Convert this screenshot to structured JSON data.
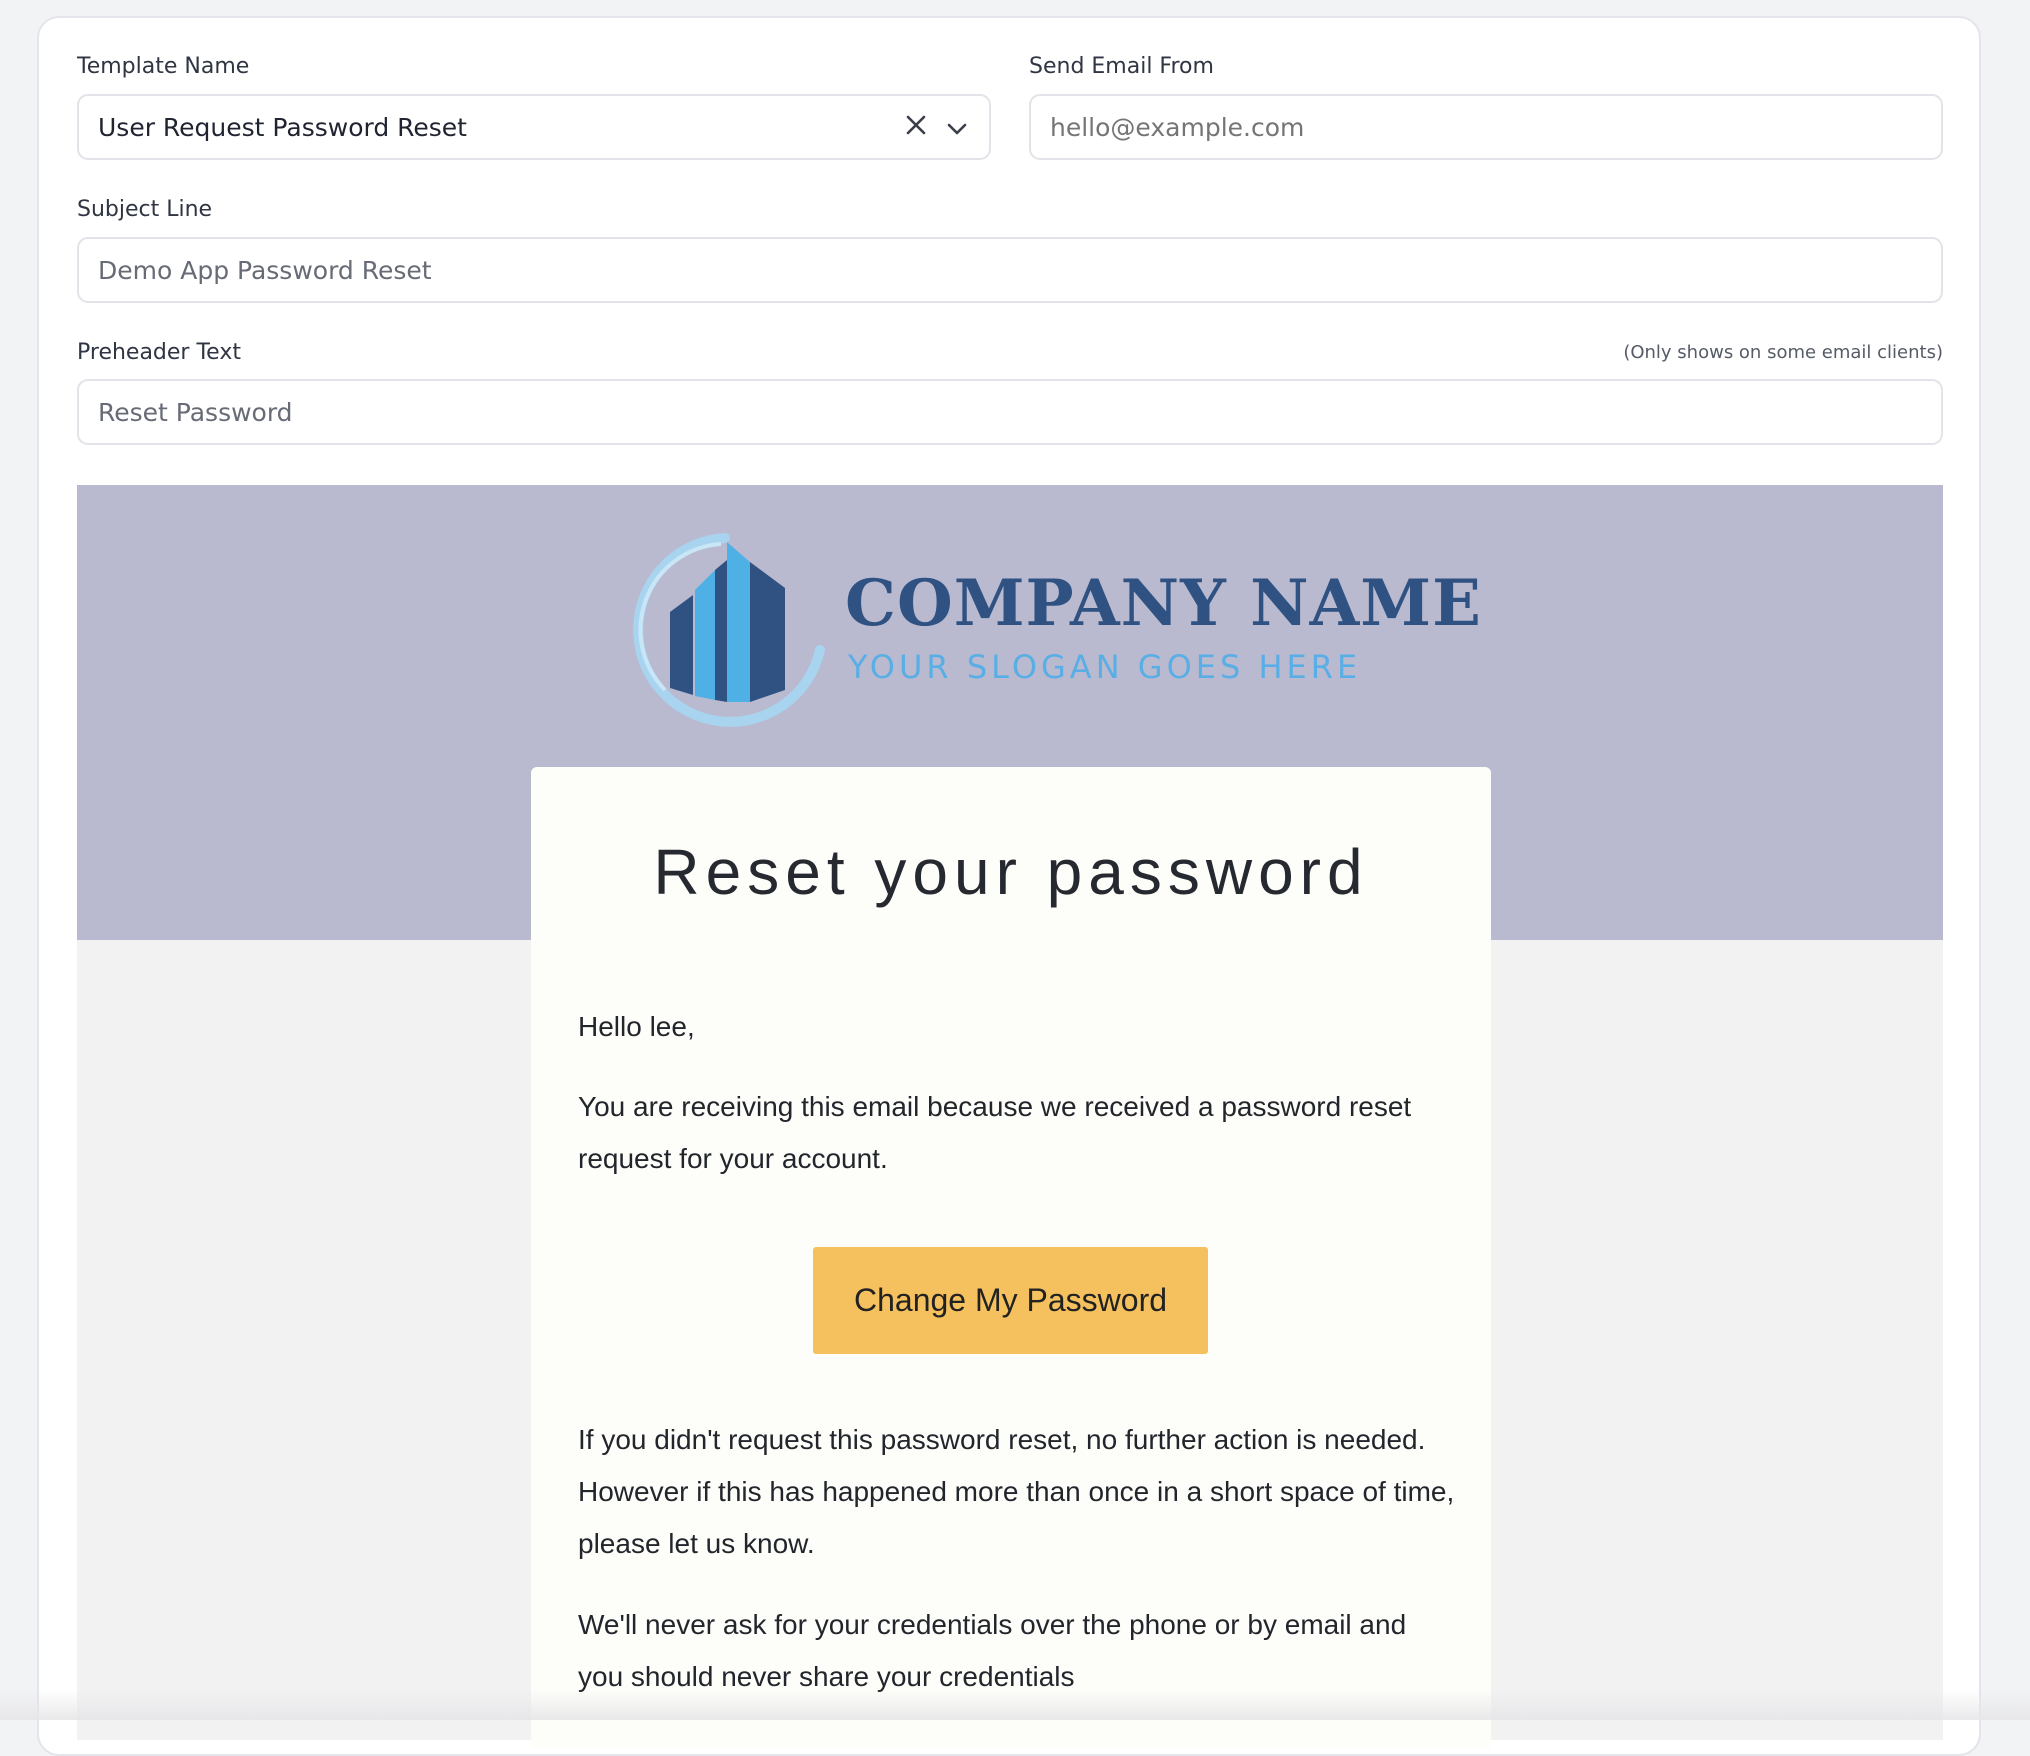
{
  "form": {
    "template_name": {
      "label": "Template Name",
      "value": "User Request Password Reset"
    },
    "send_from": {
      "label": "Send Email From",
      "placeholder": "hello@example.com"
    },
    "subject": {
      "label": "Subject Line",
      "value": "Demo App Password Reset"
    },
    "preheader": {
      "label": "Preheader Text",
      "hint": "(Only shows on some email clients)",
      "value": "Reset Password"
    }
  },
  "preview": {
    "logo": {
      "name": "COMPANY NAME",
      "slogan": "YOUR SLOGAN GOES HERE"
    },
    "title": "Reset your password",
    "greeting": "Hello lee,",
    "intro": "You are receiving this email because we received a password reset request for your account.",
    "button_label": "Change My Password",
    "notice": "If you didn't request this password reset, no further action is needed. However if this has happened more than once in a short space of time, please let us know.",
    "security": "We'll never ask for your credentials over the phone or by email and you should never share your credentials"
  },
  "colors": {
    "header_band": "#b9bad0",
    "button": "#f5c15e",
    "logo_dark": "#2f5282",
    "logo_light": "#5aaee6"
  }
}
